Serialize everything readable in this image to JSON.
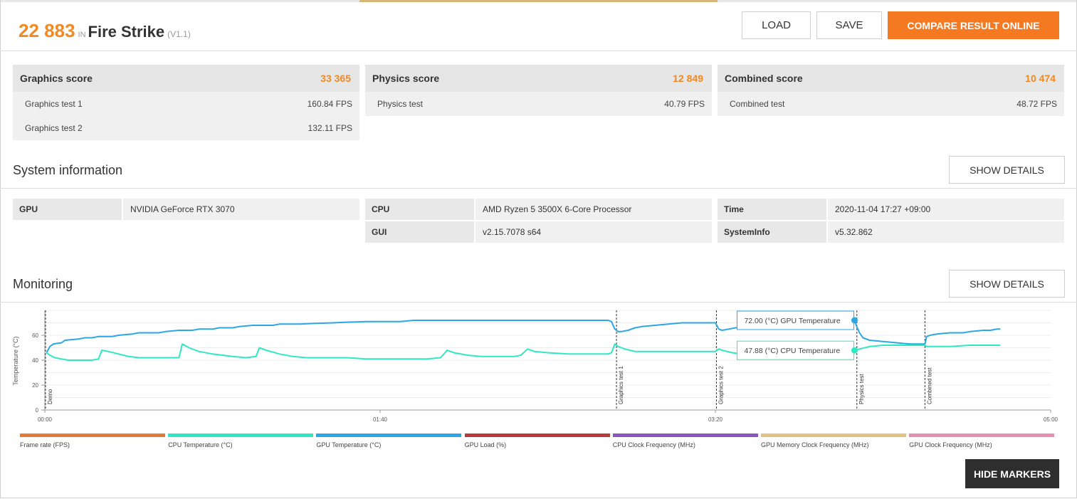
{
  "header": {
    "score": "22 883",
    "in_label": "IN",
    "benchmark": "Fire Strike",
    "version": "(V1.1)",
    "load_label": "LOAD",
    "save_label": "SAVE",
    "compare_label": "COMPARE RESULT ONLINE"
  },
  "scores": [
    {
      "label": "Graphics score",
      "value": "33 365",
      "tests": [
        {
          "name": "Graphics test 1",
          "value": "160.84 FPS"
        },
        {
          "name": "Graphics test 2",
          "value": "132.11 FPS"
        }
      ]
    },
    {
      "label": "Physics score",
      "value": "12 849",
      "tests": [
        {
          "name": "Physics test",
          "value": "40.79 FPS"
        }
      ]
    },
    {
      "label": "Combined score",
      "value": "10 474",
      "tests": [
        {
          "name": "Combined test",
          "value": "48.72 FPS"
        }
      ]
    }
  ],
  "system_info": {
    "title": "System information",
    "show_details_label": "SHOW DETAILS",
    "columns": [
      [
        {
          "key": "GPU",
          "value": "NVIDIA GeForce RTX 3070"
        }
      ],
      [
        {
          "key": "CPU",
          "value": "AMD Ryzen 5 3500X 6-Core Processor"
        },
        {
          "key": "GUI",
          "value": "v2.15.7078 s64"
        }
      ],
      [
        {
          "key": "Time",
          "value": "2020-11-04 17:27 +09:00"
        },
        {
          "key": "SystemInfo",
          "value": "v5.32.862"
        }
      ]
    ]
  },
  "monitoring": {
    "title": "Monitoring",
    "show_details_label": "SHOW DETAILS",
    "hide_markers_label": "HIDE MARKERS",
    "legend": [
      {
        "label": "Frame rate (FPS)",
        "color": "#e07b39"
      },
      {
        "label": "CPU Temperature (°C)",
        "color": "#2ee8c4"
      },
      {
        "label": "GPU Temperature (°C)",
        "color": "#2aa7e4"
      },
      {
        "label": "GPU Load (%)",
        "color": "#b83a3a"
      },
      {
        "label": "CPU Clock Frequency (MHz)",
        "color": "#8b55c0"
      },
      {
        "label": "GPU Memory Clock Frequency (MHz)",
        "color": "#e0c47f"
      },
      {
        "label": "GPU Clock Frequency (MHz)",
        "color": "#e68fb3"
      }
    ]
  },
  "chart_data": {
    "type": "line",
    "ylabel": "Temperature (°C)",
    "xlim_seconds": [
      0,
      300
    ],
    "ylim": [
      0,
      80
    ],
    "y_ticks": [
      0,
      20,
      40,
      60
    ],
    "x_ticks": [
      "00:00",
      "01:40",
      "03:20",
      "05:00"
    ],
    "grid": true,
    "markers": [
      {
        "label": "Demo",
        "x": 0.2
      },
      {
        "label": "Graphics test 1",
        "x": 170.5
      },
      {
        "label": "Graphics test 2",
        "x": 200.3
      },
      {
        "label": "Physics test",
        "x": 242.2
      },
      {
        "label": "Combined test",
        "x": 262.5
      }
    ],
    "tooltips": [
      {
        "text": "72.00 (°C) GPU Temperature",
        "x": 241.5,
        "y": 72.0,
        "color": "#2aa7e4"
      },
      {
        "text": "47.88 (°C) CPU Temperature",
        "x": 241.5,
        "y": 47.88,
        "color": "#2ee8c4"
      }
    ],
    "series": [
      {
        "name": "GPU Temperature (°C)",
        "color": "#2aa7e4",
        "points": [
          [
            0.5,
            46
          ],
          [
            1.5,
            51
          ],
          [
            2.5,
            53
          ],
          [
            5,
            54
          ],
          [
            6,
            56
          ],
          [
            10,
            57
          ],
          [
            12,
            58
          ],
          [
            14,
            58
          ],
          [
            16,
            59
          ],
          [
            20,
            59
          ],
          [
            22,
            60
          ],
          [
            26,
            61
          ],
          [
            28,
            62
          ],
          [
            34,
            62
          ],
          [
            36,
            63
          ],
          [
            40,
            64
          ],
          [
            44,
            64
          ],
          [
            46,
            65
          ],
          [
            50,
            65
          ],
          [
            52,
            66
          ],
          [
            56,
            66
          ],
          [
            58,
            67
          ],
          [
            62,
            68
          ],
          [
            68,
            68
          ],
          [
            70,
            69
          ],
          [
            76,
            69
          ],
          [
            80,
            69.5
          ],
          [
            86,
            70
          ],
          [
            90,
            70.5
          ],
          [
            96,
            71
          ],
          [
            102,
            71
          ],
          [
            104,
            71
          ],
          [
            106,
            71
          ],
          [
            110,
            72
          ],
          [
            118,
            72
          ],
          [
            126,
            72
          ],
          [
            130,
            72
          ],
          [
            138,
            72
          ],
          [
            150,
            72
          ],
          [
            162,
            72
          ],
          [
            168,
            72
          ],
          [
            169,
            71
          ],
          [
            170,
            65
          ],
          [
            171,
            63
          ],
          [
            172,
            63
          ],
          [
            174,
            64
          ],
          [
            176,
            66
          ],
          [
            178,
            67
          ],
          [
            182,
            68
          ],
          [
            186,
            69
          ],
          [
            190,
            70
          ],
          [
            196,
            70
          ],
          [
            199,
            70
          ],
          [
            200,
            70
          ],
          [
            201,
            65
          ],
          [
            202,
            64
          ],
          [
            204,
            65
          ],
          [
            206,
            66
          ],
          [
            210,
            67
          ],
          [
            212,
            67
          ],
          [
            214,
            68
          ],
          [
            220,
            68
          ],
          [
            226,
            68
          ],
          [
            230,
            69
          ],
          [
            236,
            70
          ],
          [
            240,
            71
          ],
          [
            241.5,
            72
          ],
          [
            242,
            68
          ],
          [
            243,
            62
          ],
          [
            244,
            58
          ],
          [
            246,
            56
          ],
          [
            250,
            55
          ],
          [
            254,
            54
          ],
          [
            258,
            53
          ],
          [
            262,
            53
          ],
          [
            262.5,
            53
          ],
          [
            263,
            59
          ],
          [
            264,
            60
          ],
          [
            266,
            61
          ],
          [
            270,
            62
          ],
          [
            274,
            62
          ],
          [
            276,
            63
          ],
          [
            280,
            64
          ],
          [
            282,
            64
          ],
          [
            284,
            65
          ],
          [
            285,
            65
          ]
        ]
      },
      {
        "name": "CPU Temperature (°C)",
        "color": "#2ee8c4",
        "points": [
          [
            0.5,
            46
          ],
          [
            1.5,
            44
          ],
          [
            3,
            42
          ],
          [
            5,
            41
          ],
          [
            7,
            40
          ],
          [
            10,
            40
          ],
          [
            14,
            40
          ],
          [
            16,
            41
          ],
          [
            17,
            48
          ],
          [
            19,
            47
          ],
          [
            22,
            45
          ],
          [
            25,
            43
          ],
          [
            28,
            42
          ],
          [
            32,
            42
          ],
          [
            36,
            42
          ],
          [
            38,
            42
          ],
          [
            40,
            42
          ],
          [
            41,
            53
          ],
          [
            43,
            50
          ],
          [
            46,
            47
          ],
          [
            50,
            45
          ],
          [
            53,
            44
          ],
          [
            56,
            43
          ],
          [
            60,
            42
          ],
          [
            63,
            43
          ],
          [
            64,
            50
          ],
          [
            66,
            48
          ],
          [
            70,
            45
          ],
          [
            74,
            43
          ],
          [
            78,
            42
          ],
          [
            84,
            42
          ],
          [
            90,
            42
          ],
          [
            96,
            41
          ],
          [
            102,
            41
          ],
          [
            108,
            41
          ],
          [
            114,
            41
          ],
          [
            118,
            42
          ],
          [
            120,
            48
          ],
          [
            122,
            46
          ],
          [
            126,
            44
          ],
          [
            130,
            43
          ],
          [
            136,
            43
          ],
          [
            140,
            43
          ],
          [
            142,
            44
          ],
          [
            144,
            49
          ],
          [
            146,
            47
          ],
          [
            150,
            46
          ],
          [
            156,
            45
          ],
          [
            160,
            45
          ],
          [
            166,
            45
          ],
          [
            168,
            45
          ],
          [
            169,
            46
          ],
          [
            170,
            53
          ],
          [
            171,
            51
          ],
          [
            173,
            49
          ],
          [
            176,
            47
          ],
          [
            180,
            47
          ],
          [
            186,
            47
          ],
          [
            190,
            47
          ],
          [
            196,
            47
          ],
          [
            199,
            47
          ],
          [
            200,
            47
          ],
          [
            201,
            49
          ],
          [
            202,
            48
          ],
          [
            205,
            46
          ],
          [
            208,
            45
          ],
          [
            212,
            45
          ],
          [
            216,
            45
          ],
          [
            218,
            46
          ],
          [
            219,
            54
          ],
          [
            221,
            52
          ],
          [
            224,
            50
          ],
          [
            228,
            49
          ],
          [
            232,
            48
          ],
          [
            236,
            48
          ],
          [
            238,
            50
          ],
          [
            239,
            51
          ],
          [
            241.5,
            47.88
          ],
          [
            243,
            49
          ],
          [
            246,
            51
          ],
          [
            250,
            52
          ],
          [
            256,
            52
          ],
          [
            262,
            52
          ],
          [
            262.5,
            52
          ],
          [
            263,
            51
          ],
          [
            266,
            51
          ],
          [
            270,
            51
          ],
          [
            276,
            52
          ],
          [
            282,
            52
          ],
          [
            285,
            52
          ]
        ]
      }
    ]
  }
}
